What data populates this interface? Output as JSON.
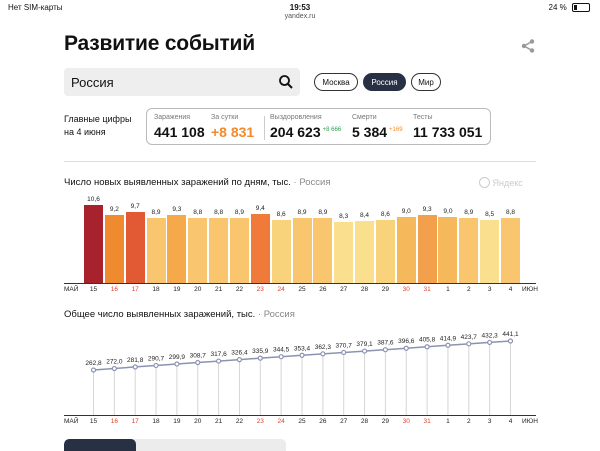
{
  "status": {
    "carrier": "Нет SIM-карты",
    "time": "19:53",
    "url": "yandex.ru",
    "battery": "24 %"
  },
  "page": {
    "title": "Развитие событий"
  },
  "search": {
    "value": "Россия"
  },
  "region_tabs": [
    "Москва",
    "Россия",
    "Мир"
  ],
  "key_figures": {
    "label_line1": "Главные цифры",
    "label_line2": "на 4 июня",
    "infected_label": "Заражения",
    "infected_value": "441 108",
    "daily_label": "За сутки",
    "daily_value": "+8 831",
    "recovered_label": "Выздоровления",
    "recovered_value": "204 623",
    "recovered_delta": "+8 666",
    "deaths_label": "Смерти",
    "deaths_value": "5 384",
    "deaths_delta": "+169",
    "tests_label": "Тесты",
    "tests_value": "11 733 051"
  },
  "logo_text": "Яндекс",
  "colors": {
    "accent_orange": "#f08a2e",
    "delta_green": "#2e9e4f",
    "delta_orange": "#f08a2e",
    "active_pill": "#283044",
    "weekend_red": "#e0412b",
    "line_color": "#8a94b0"
  },
  "chart_data": [
    {
      "type": "bar",
      "title": "Число новых выявленных заражений по дням, тыс.",
      "region": "Россия",
      "categories": [
        "15",
        "16",
        "17",
        "18",
        "19",
        "20",
        "21",
        "22",
        "23",
        "24",
        "25",
        "26",
        "27",
        "28",
        "29",
        "30",
        "31",
        "1",
        "2",
        "3",
        "4"
      ],
      "values": [
        10.6,
        9.2,
        9.7,
        8.9,
        9.3,
        8.8,
        8.8,
        8.9,
        9.4,
        8.6,
        8.9,
        8.9,
        8.3,
        8.4,
        8.6,
        9.0,
        9.3,
        9.0,
        8.9,
        8.5,
        8.8
      ],
      "value_labels": [
        "10,6",
        "9,2",
        "9,7",
        "8,9",
        "9,3",
        "8,8",
        "8,8",
        "8,9",
        "9,4",
        "8,6",
        "8,9",
        "8,9",
        "8,3",
        "8,4",
        "8,6",
        "9,0",
        "9,3",
        "9,0",
        "8,9",
        "8,5",
        "8,8"
      ],
      "bar_colors": [
        "#a7222c",
        "#f08a2e",
        "#e25a34",
        "#f9c66f",
        "#f5a94b",
        "#f9c66f",
        "#f9c66f",
        "#f9c66f",
        "#f07a3a",
        "#f9d27c",
        "#f9c66f",
        "#f9c66f",
        "#fadf8f",
        "#fadf8f",
        "#f9d27c",
        "#f5b85a",
        "#f2a04c",
        "#f5b85a",
        "#f9c66f",
        "#fadf8f",
        "#f9c66f"
      ],
      "weekend_indices": [
        1,
        2,
        8,
        9,
        15,
        16
      ],
      "month_start": "МАЙ",
      "month_end": "ИЮН"
    },
    {
      "type": "line",
      "title": "Общее число выявленных заражений, тыс.",
      "region": "Россия",
      "categories": [
        "15",
        "16",
        "17",
        "18",
        "19",
        "20",
        "21",
        "22",
        "23",
        "24",
        "25",
        "26",
        "27",
        "28",
        "29",
        "30",
        "31",
        "1",
        "2",
        "3",
        "4"
      ],
      "values": [
        262.8,
        272.0,
        281.8,
        290.7,
        299.9,
        308.7,
        317.6,
        326.4,
        335.9,
        344.5,
        353.4,
        362.3,
        370.7,
        379.1,
        387.6,
        396.6,
        405.8,
        414.9,
        423.7,
        432.3,
        441.1
      ],
      "value_labels": [
        "262,8",
        "272,0",
        "281,8",
        "290,7",
        "299,9",
        "308,7",
        "317,6",
        "326,4",
        "335,9",
        "344,5",
        "353,4",
        "362,3",
        "370,7",
        "379,1",
        "387,6",
        "396,6",
        "405,8",
        "414,9",
        "423,7",
        "432,3",
        "441,1"
      ],
      "weekend_indices": [
        1,
        2,
        8,
        9,
        15,
        16
      ],
      "month_start": "МАЙ",
      "month_end": "ИЮН"
    }
  ]
}
